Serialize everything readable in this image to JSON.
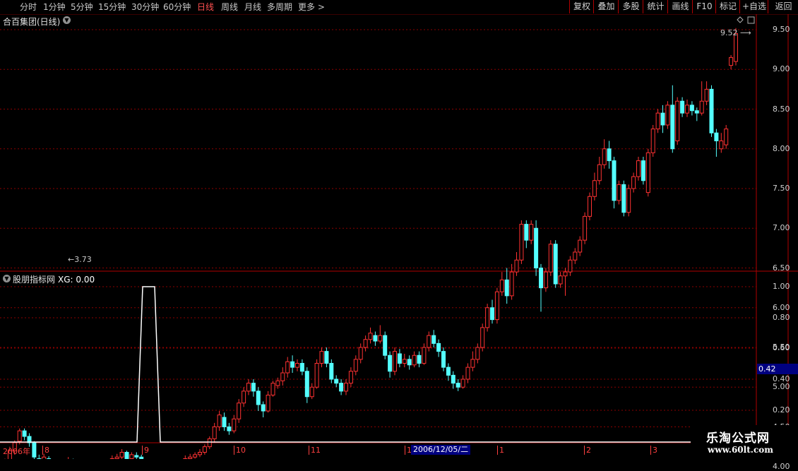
{
  "toolbar": {
    "periods": [
      {
        "label": "分时",
        "active": false
      },
      {
        "label": "1分钟",
        "active": false
      },
      {
        "label": "5分钟",
        "active": false
      },
      {
        "label": "15分钟",
        "active": false
      },
      {
        "label": "30分钟",
        "active": false
      },
      {
        "label": "60分钟",
        "active": false
      },
      {
        "label": "日线",
        "active": true
      },
      {
        "label": "周线",
        "active": false
      },
      {
        "label": "月线",
        "active": false
      },
      {
        "label": "多周期",
        "active": false
      },
      {
        "label": "更多 >",
        "active": false
      }
    ],
    "right_buttons": [
      "复权",
      "叠加",
      "多股",
      "统计",
      "画线",
      "F10",
      "标记",
      "+自选",
      "返回"
    ]
  },
  "main_chart": {
    "title": "合百集团(日线)",
    "y_ticks": [
      "9.50",
      "9.00",
      "8.50",
      "8.00",
      "7.50",
      "7.00",
      "6.50",
      "6.00",
      "5.50",
      "5.00",
      "4.50",
      "4.00"
    ],
    "high_label": "9.52",
    "low_label": "3.73"
  },
  "indicator": {
    "title": "股朋指标网",
    "xg_label": "XG: 0.00",
    "y_ticks": [
      "1.00",
      "0.80",
      "0.60",
      "0.40",
      "0.20"
    ],
    "cursor_value": "0.42"
  },
  "date_axis": {
    "labels": [
      "2006年",
      "8",
      "9",
      "10",
      "11",
      "1",
      "1",
      "2",
      "3"
    ],
    "cursor_date": "2006/12/05/二"
  },
  "watermark": {
    "line1": "乐淘公式网",
    "line2": "www.60lt.com"
  },
  "colors": {
    "up": "#ff3232",
    "down": "#54ffff",
    "grid": "#8b0000",
    "frame": "#b00000"
  },
  "chart_data": {
    "type": "candlestick",
    "ylim": [
      3.7,
      9.6
    ],
    "candles": [
      [
        3.92,
        4.08,
        3.88,
        4.1
      ],
      [
        4.08,
        4.2,
        4.05,
        4.25
      ],
      [
        4.2,
        4.3,
        4.15,
        4.33
      ],
      [
        4.32,
        4.45,
        4.28,
        4.48
      ],
      [
        4.45,
        4.38,
        4.33,
        4.48
      ],
      [
        4.38,
        4.3,
        4.25,
        4.42
      ],
      [
        4.3,
        4.12,
        4.08,
        4.32
      ],
      [
        4.1,
        4.05,
        4.0,
        4.15
      ],
      [
        4.05,
        4.12,
        4.0,
        4.16
      ],
      [
        4.1,
        3.95,
        3.88,
        4.13
      ],
      [
        3.95,
        3.78,
        3.73,
        3.98
      ],
      [
        3.8,
        3.95,
        3.76,
        4.0
      ],
      [
        3.95,
        4.05,
        3.92,
        4.09
      ],
      [
        4.03,
        4.08,
        4.0,
        4.12
      ],
      [
        4.06,
        4.0,
        3.96,
        4.1
      ],
      [
        4.0,
        3.9,
        3.85,
        4.03
      ],
      [
        3.9,
        4.0,
        3.86,
        4.03
      ],
      [
        4.0,
        3.92,
        3.88,
        4.04
      ],
      [
        3.9,
        3.85,
        3.82,
        3.94
      ],
      [
        3.85,
        3.95,
        3.83,
        3.98
      ],
      [
        3.95,
        3.98,
        3.92,
        4.02
      ],
      [
        3.97,
        4.05,
        3.95,
        4.08
      ],
      [
        4.05,
        4.1,
        4.02,
        4.14
      ],
      [
        4.1,
        4.12,
        4.06,
        4.16
      ],
      [
        4.12,
        4.18,
        4.08,
        4.22
      ],
      [
        4.18,
        4.1,
        4.06,
        4.2
      ],
      [
        4.1,
        4.15,
        4.08,
        4.18
      ],
      [
        4.14,
        4.12,
        4.08,
        4.18
      ],
      [
        4.12,
        4.06,
        4.02,
        4.15
      ],
      [
        4.06,
        4.02,
        3.98,
        4.08
      ],
      [
        4.02,
        3.98,
        3.95,
        4.05
      ],
      [
        3.98,
        3.92,
        3.89,
        4.01
      ],
      [
        3.92,
        3.96,
        3.9,
        3.99
      ],
      [
        3.96,
        4.0,
        3.94,
        4.03
      ],
      [
        4.0,
        4.02,
        3.97,
        4.05
      ],
      [
        4.02,
        3.98,
        3.95,
        4.05
      ],
      [
        3.98,
        4.05,
        3.96,
        4.08
      ],
      [
        4.05,
        4.1,
        4.03,
        4.14
      ],
      [
        4.1,
        4.12,
        4.08,
        4.16
      ],
      [
        4.12,
        4.15,
        4.1,
        4.18
      ],
      [
        4.15,
        4.18,
        4.12,
        4.22
      ],
      [
        4.18,
        4.25,
        4.15,
        4.28
      ],
      [
        4.25,
        4.35,
        4.22,
        4.38
      ],
      [
        4.35,
        4.5,
        4.3,
        4.55
      ],
      [
        4.5,
        4.65,
        4.45,
        4.7
      ],
      [
        4.62,
        4.5,
        4.45,
        4.68
      ],
      [
        4.5,
        4.45,
        4.4,
        4.55
      ],
      [
        4.45,
        4.6,
        4.42,
        4.65
      ],
      [
        4.6,
        4.8,
        4.55,
        4.85
      ],
      [
        4.8,
        4.95,
        4.75,
        5.0
      ],
      [
        4.95,
        5.05,
        4.9,
        5.1
      ],
      [
        5.05,
        4.95,
        4.88,
        5.1
      ],
      [
        4.95,
        4.78,
        4.7,
        5.0
      ],
      [
        4.78,
        4.7,
        4.62,
        4.82
      ],
      [
        4.7,
        4.9,
        4.68,
        4.95
      ],
      [
        4.9,
        5.05,
        4.88,
        5.08
      ],
      [
        5.02,
        5.08,
        4.98,
        5.12
      ],
      [
        5.08,
        5.18,
        5.02,
        5.25
      ],
      [
        5.18,
        5.32,
        5.12,
        5.38
      ],
      [
        5.32,
        5.25,
        5.18,
        5.4
      ],
      [
        5.25,
        5.3,
        5.2,
        5.35
      ],
      [
        5.3,
        5.2,
        5.15,
        5.35
      ],
      [
        5.2,
        4.88,
        4.8,
        5.25
      ],
      [
        4.88,
        5.0,
        4.85,
        5.05
      ],
      [
        5.0,
        5.3,
        4.98,
        5.35
      ],
      [
        5.3,
        5.45,
        5.25,
        5.5
      ],
      [
        5.45,
        5.3,
        5.25,
        5.5
      ],
      [
        5.3,
        5.1,
        5.05,
        5.35
      ],
      [
        5.1,
        5.05,
        5.0,
        5.15
      ],
      [
        5.05,
        4.95,
        4.9,
        5.1
      ],
      [
        4.95,
        5.05,
        4.9,
        5.1
      ],
      [
        5.05,
        5.2,
        5.0,
        5.25
      ],
      [
        5.2,
        5.35,
        5.15,
        5.4
      ],
      [
        5.35,
        5.5,
        5.3,
        5.55
      ],
      [
        5.5,
        5.6,
        5.45,
        5.65
      ],
      [
        5.6,
        5.68,
        5.55,
        5.75
      ],
      [
        5.65,
        5.58,
        5.52,
        5.7
      ],
      [
        5.58,
        5.65,
        5.55,
        5.78
      ],
      [
        5.65,
        5.4,
        5.35,
        5.7
      ],
      [
        5.4,
        5.2,
        5.12,
        5.45
      ],
      [
        5.2,
        5.45,
        5.15,
        5.5
      ],
      [
        5.42,
        5.3,
        5.25,
        5.48
      ],
      [
        5.3,
        5.35,
        5.25,
        5.42
      ],
      [
        5.35,
        5.28,
        5.22,
        5.4
      ],
      [
        5.28,
        5.4,
        5.25,
        5.45
      ],
      [
        5.4,
        5.3,
        5.25,
        5.45
      ],
      [
        5.3,
        5.5,
        5.28,
        5.55
      ],
      [
        5.5,
        5.65,
        5.45,
        5.7
      ],
      [
        5.65,
        5.55,
        5.5,
        5.72
      ],
      [
        5.55,
        5.45,
        5.38,
        5.6
      ],
      [
        5.45,
        5.25,
        5.2,
        5.5
      ],
      [
        5.25,
        5.15,
        5.08,
        5.3
      ],
      [
        5.15,
        5.05,
        4.98,
        5.2
      ],
      [
        5.05,
        5.0,
        4.95,
        5.1
      ],
      [
        5.0,
        5.1,
        4.98,
        5.15
      ],
      [
        5.1,
        5.25,
        5.05,
        5.3
      ],
      [
        5.25,
        5.35,
        5.2,
        5.45
      ],
      [
        5.35,
        5.5,
        5.3,
        5.55
      ],
      [
        5.5,
        5.75,
        5.45,
        5.8
      ],
      [
        5.75,
        6.0,
        5.7,
        6.05
      ],
      [
        6.0,
        5.85,
        5.8,
        6.1
      ],
      [
        5.85,
        6.2,
        5.8,
        6.25
      ],
      [
        6.2,
        6.35,
        6.15,
        6.45
      ],
      [
        6.35,
        6.15,
        6.05,
        6.5
      ],
      [
        6.15,
        6.45,
        6.1,
        6.55
      ],
      [
        6.45,
        6.6,
        6.4,
        6.7
      ],
      [
        6.6,
        7.05,
        6.55,
        7.1
      ],
      [
        7.05,
        6.85,
        6.75,
        7.1
      ],
      [
        6.85,
        7.05,
        6.8,
        7.1
      ],
      [
        7.0,
        6.5,
        6.4,
        7.1
      ],
      [
        6.5,
        6.25,
        5.95,
        6.55
      ],
      [
        6.25,
        6.45,
        6.2,
        6.5
      ],
      [
        6.45,
        6.8,
        6.4,
        6.85
      ],
      [
        6.8,
        6.3,
        6.25,
        6.85
      ],
      [
        6.3,
        6.4,
        6.25,
        6.45
      ],
      [
        6.4,
        6.45,
        6.15,
        6.5
      ],
      [
        6.45,
        6.6,
        6.4,
        6.65
      ],
      [
        6.6,
        6.7,
        6.55,
        6.75
      ],
      [
        6.7,
        6.85,
        6.65,
        6.9
      ],
      [
        6.85,
        7.15,
        6.8,
        7.2
      ],
      [
        7.15,
        7.4,
        7.1,
        7.45
      ],
      [
        7.4,
        7.6,
        7.35,
        7.7
      ],
      [
        7.6,
        7.8,
        7.55,
        7.9
      ],
      [
        7.8,
        8.0,
        7.75,
        8.12
      ],
      [
        8.0,
        7.85,
        7.75,
        8.1
      ],
      [
        7.85,
        7.35,
        7.25,
        7.9
      ],
      [
        7.35,
        7.55,
        7.3,
        7.6
      ],
      [
        7.55,
        7.2,
        7.15,
        7.6
      ],
      [
        7.2,
        7.5,
        7.15,
        7.55
      ],
      [
        7.5,
        7.65,
        7.45,
        7.7
      ],
      [
        7.65,
        7.85,
        7.6,
        7.9
      ],
      [
        7.85,
        7.6,
        7.55,
        7.9
      ],
      [
        7.45,
        7.95,
        7.4,
        8.0
      ],
      [
        7.95,
        8.25,
        7.9,
        8.3
      ],
      [
        8.25,
        8.45,
        8.2,
        8.5
      ],
      [
        8.45,
        8.3,
        8.2,
        8.55
      ],
      [
        8.3,
        8.55,
        8.25,
        8.6
      ],
      [
        8.55,
        8.0,
        7.95,
        8.8
      ],
      [
        8.1,
        8.6,
        8.05,
        8.65
      ],
      [
        8.6,
        8.45,
        8.4,
        8.65
      ],
      [
        8.45,
        8.55,
        8.4,
        8.62
      ],
      [
        8.55,
        8.48,
        8.42,
        8.6
      ],
      [
        8.48,
        8.45,
        8.35,
        8.52
      ],
      [
        8.45,
        8.6,
        8.42,
        8.85
      ],
      [
        8.6,
        8.75,
        8.55,
        8.85
      ],
      [
        8.75,
        8.2,
        8.15,
        8.8
      ],
      [
        8.2,
        8.1,
        7.9,
        8.25
      ],
      [
        8.0,
        8.1,
        7.95,
        8.2
      ],
      [
        8.05,
        8.25,
        8.0,
        8.3
      ],
      [
        9.05,
        9.15,
        9.0,
        9.18
      ],
      [
        9.1,
        9.45,
        9.05,
        9.52
      ]
    ]
  }
}
